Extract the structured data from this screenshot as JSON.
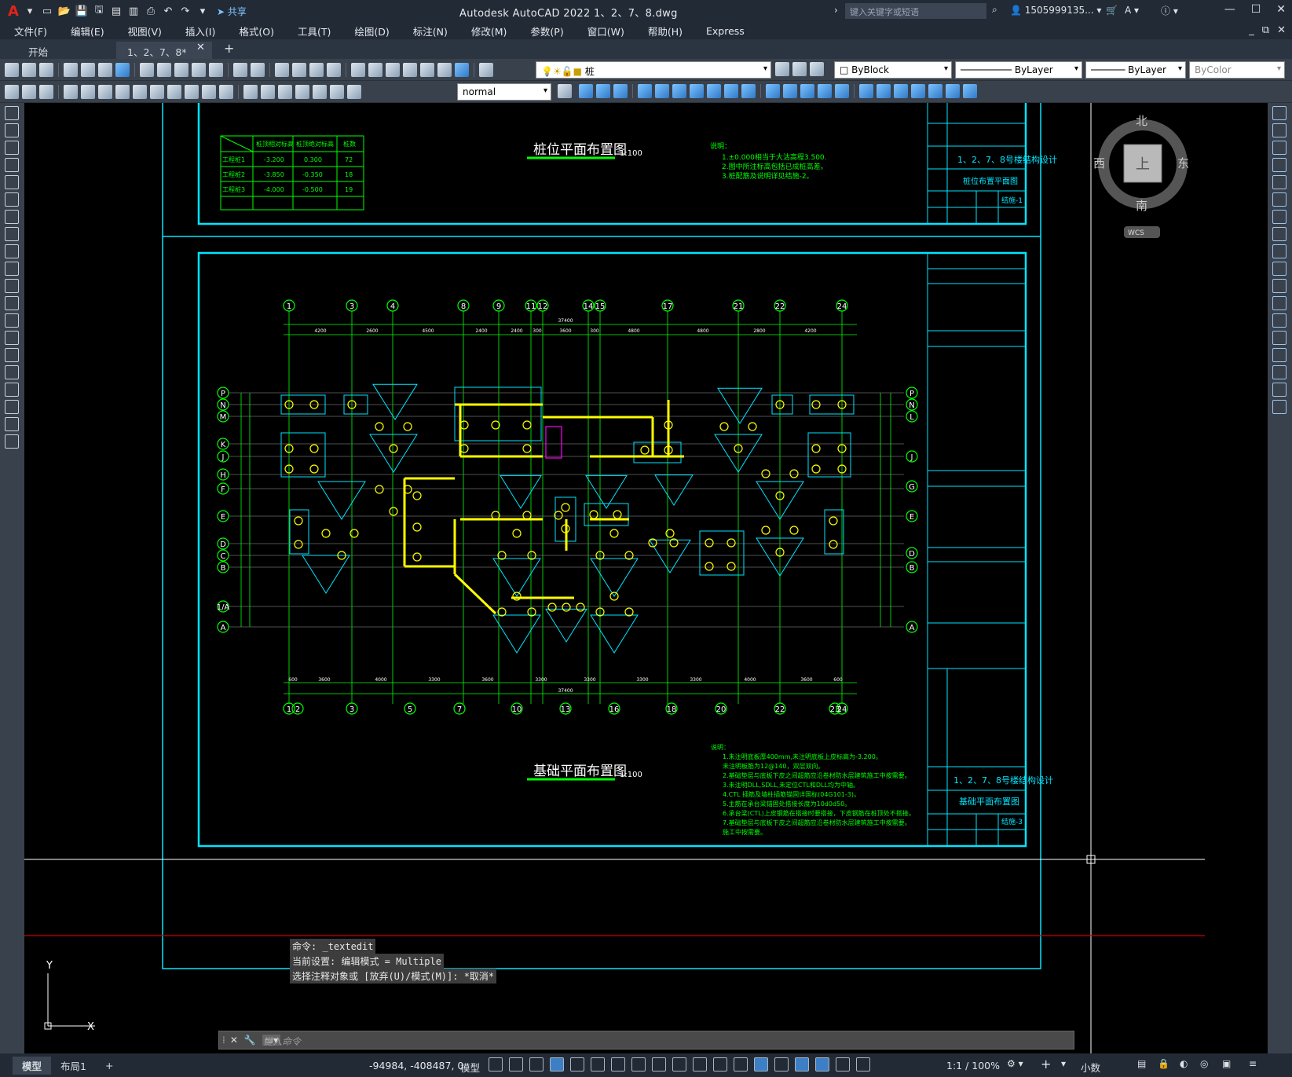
{
  "titlebar": {
    "title": "Autodesk AutoCAD 2022    1、2、7、8.dwg",
    "search_placeholder": "键入关键字或短语",
    "user": "1505999135...",
    "share": "共享"
  },
  "menu": [
    "文件(F)",
    "编辑(E)",
    "视图(V)",
    "插入(I)",
    "格式(O)",
    "工具(T)",
    "绘图(D)",
    "标注(N)",
    "修改(M)",
    "参数(P)",
    "窗口(W)",
    "帮助(H)",
    "Express"
  ],
  "tabs": [
    {
      "label": "开始"
    },
    {
      "label": "1、2、7、8*"
    }
  ],
  "layers": {
    "current_layer": "桩",
    "color": "ByBlock",
    "linetype": "ByLayer",
    "lineweight": "ByLayer",
    "plotstyle": "ByColor",
    "textstyle": "normal"
  },
  "viewcube": {
    "north": "北",
    "south": "南",
    "east": "东",
    "west": "西",
    "top": "上",
    "wcs": "WCS"
  },
  "drawing": {
    "pile_title": "桩位平面布置图",
    "pile_scale": "1:100",
    "found_title": "基础平面布置图",
    "found_scale": "1:100",
    "pile_table": {
      "headers": [
        "桩顶相对标高",
        "桩顶绝对标高",
        "桩数"
      ],
      "rows": [
        [
          "工程桩1",
          "-3.200",
          "0.300",
          "72"
        ],
        [
          "工程桩2",
          "-3.850",
          "-0.350",
          "18"
        ],
        [
          "工程桩3",
          "-4.000",
          "-0.500",
          "19"
        ]
      ]
    },
    "pile_notes": [
      "说明：",
      "1.±0.000相当于大沽高程3.500.",
      "2.图中所注标高包括已成桩高差。",
      "3.桩配筋及说明详见结施-2。"
    ],
    "found_notes": [
      "说明：",
      "1.未注明底板厚400mm,未注明底板上皮标高为-3.200。",
      "  未注明板筋为12@140，双层双向。",
      "2.基础垫层与底板下皮之间超筋应沿卷材防水层建筑施工中按需要。",
      "3.未注明DLL,SDLL,未定位CTL和DLL均为中轴。",
      "4.CTL 插筋及墙柱插筋锚固详国标(04G101-3)。",
      "5.主筋在承台梁锚固处搭接长度为10d0d50。",
      "6.承台梁(CTL)上皮钢筋在搭接时要搭接，下皮钢筋在桩顶处不搭接。",
      "7.基础垫层与底板下皮之间超筋应沿卷材防水层建筑施工中按需要。",
      "  施工中按需要。"
    ],
    "title_block_top": {
      "project": "1、2、7、8号楼结构设计",
      "sheet": "桩位布置平面图",
      "no": "结施-1"
    },
    "title_block_bottom": {
      "project": "1、2、7、8号楼结构设计",
      "sheet": "基础平面布置图",
      "no": "结施-3"
    },
    "grid_top": [
      "1",
      "3",
      "4",
      "8",
      "9",
      "11",
      "12",
      "14",
      "15",
      "17",
      "21",
      "22",
      "24"
    ],
    "grid_bottom": [
      "1",
      "2",
      "3",
      "5",
      "7",
      "10",
      "13",
      "16",
      "18",
      "20",
      "22",
      "23",
      "24"
    ],
    "grid_left": [
      "P",
      "N",
      "M",
      "K",
      "J",
      "H",
      "F",
      "E",
      "D",
      "C",
      "B",
      "1/A",
      "A"
    ],
    "grid_right": [
      "P",
      "N",
      "L",
      "J",
      "G",
      "E",
      "D",
      "B",
      "A"
    ],
    "dims_top": [
      "4200",
      "2600",
      "4500",
      "2400",
      "2400",
      "300",
      "3600",
      "300",
      "4800",
      "4800",
      "2800",
      "4200"
    ],
    "dims_bottom": [
      "600",
      "3600",
      "4000",
      "3300",
      "3600",
      "3300",
      "3300",
      "3300",
      "3300",
      "4000",
      "3600",
      "600"
    ],
    "overall_top": "37400",
    "overall_bottom": "37400"
  },
  "command": {
    "history": [
      "命令: _textedit",
      "当前设置: 编辑模式 = Multiple",
      "选择注释对象或 [放弃(U)/模式(M)]: *取消*"
    ],
    "placeholder": "键入命令"
  },
  "status": {
    "tabs": [
      "模型",
      "布局1"
    ],
    "coords": "-94984, -408487, 0",
    "model": "模型",
    "scale": "1:1 / 100%",
    "unit": "小数"
  },
  "colors": {
    "accent": "#00e5ff",
    "grid": "#00ff00",
    "yellow": "#ffff00",
    "magenta": "#ff00ff",
    "titlebar": "#222a35",
    "toolbar": "#39414c"
  }
}
